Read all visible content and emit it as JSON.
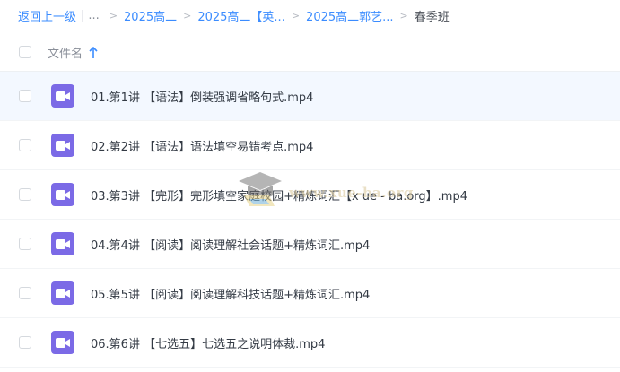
{
  "breadcrumb": {
    "back_label": "返回上一级",
    "ellipsis": "...",
    "items": [
      "2025高二",
      "2025高二【英...",
      "2025高二郭艺..."
    ],
    "current": "春季班"
  },
  "header": {
    "column_label": "文件名",
    "sort_icon": "arrow-up-icon",
    "accent_color": "#3b8cff"
  },
  "files": [
    {
      "name": "01.第1讲 【语法】倒装强调省略句式.mp4",
      "icon": "video-file-icon"
    },
    {
      "name": "02.第2讲 【语法】语法填空易错考点.mp4",
      "icon": "video-file-icon"
    },
    {
      "name": "03.第3讲 【完形】完形填空家庭校园+精炼词汇【x ue - ba.org】.mp4",
      "icon": "video-file-icon"
    },
    {
      "name": "04.第4讲 【阅读】阅读理解社会话题+精炼词汇.mp4",
      "icon": "video-file-icon"
    },
    {
      "name": "05.第5讲 【阅读】阅读理解科技话题+精炼词汇.mp4",
      "icon": "video-file-icon"
    },
    {
      "name": "06.第6讲 【七选五】七选五之说明体裁.mp4",
      "icon": "video-file-icon"
    }
  ],
  "watermark": {
    "text": "www.xue-ba.org"
  },
  "colors": {
    "video_icon": "#7b6ae6",
    "row_highlight": "#f3f8ff",
    "link": "#3b8cff"
  }
}
